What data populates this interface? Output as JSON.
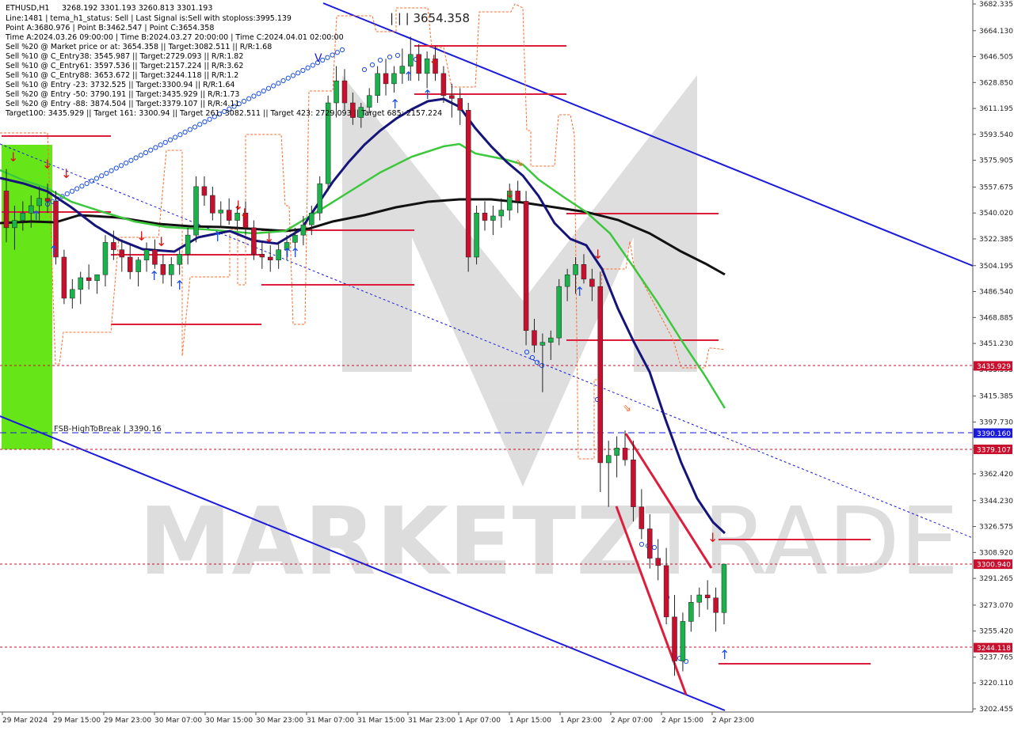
{
  "header": {
    "title": "ETHUSD,H1",
    "ohlc": "3268.192 3301.193 3260.813 3301.193",
    "line2": "Line:1481  |  tema_h1_status: Sell  |  Last Signal is:Sell with stoploss:3995.139",
    "line3": "Point A:3680.976  |  Point B:3462.547  |  Point C:3654.358",
    "line4": "Time A:2024.03.26 09:00:00  |  Time B:2024.03.27 20:00:00  |  Time C:2024.04.01 02:00:00",
    "line5": "Sell %20 @ Market price or at: 3654.358  ||  Target:3082.511  ||  R/R:1.68",
    "line6": "Sell %10 @ C_Entry38: 3545.987  ||  Target:2729.093  ||  R/R:1.82",
    "line7": "Sell %10 @ C_Entry61: 3597.536  ||  Target:2157.224  ||  R/R:3.62",
    "line8": "Sell %10 @ C_Entry88: 3653.672  ||  Target:3244.118  ||  R/R:1.2",
    "line9": "Sell %10 @ Entry -23: 3732.525  ||  Target:3300.94  ||  R/R:1.64",
    "line10": "Sell %20 @ Entry -50: 3790.191  ||  Target:3435.929  ||  R/R:1.73",
    "line11": "Sell %20 @ Entry -88: 3874.504  ||  Target:3379.107  ||  R/R:4.11",
    "line12": "Target100: 3435.929  ||  Target 161: 3300.94  ||  Target 261: 3082.511  ||  Target 423: 2729.093  ||  Target 685: 2157.224"
  },
  "annotations": {
    "point_c_label": "| | | 3654.358",
    "fsb_label": "FSB-HighToBreak  |  3390.16",
    "v_mark": "V"
  },
  "watermark": {
    "text_left": "MARKETZ",
    "text_right": "TRADE"
  },
  "colors": {
    "up_candle": "#19b24b",
    "down_candle": "#c8102e",
    "channel": "#1a1adb",
    "ma_dark_blue": "#14147a",
    "ma_green": "#3cc83c",
    "ma_black": "#111111",
    "level_red": "#dc1e3c",
    "envelope_orange": "#ff6a2a",
    "green_zone": "#66e619"
  },
  "chart_data": {
    "type": "candlestick",
    "symbol": "ETHUSD",
    "timeframe": "H1",
    "ylim": [
      3202.455,
      3682.335
    ],
    "y_ticks": [
      "3682.335",
      "3664.130",
      "3646.505",
      "3628.850",
      "3611.195",
      "3593.540",
      "3575.905",
      "3557.675",
      "3540.020",
      "3522.385",
      "3504.195",
      "3486.540",
      "3468.885",
      "3451.230",
      "3433.595",
      "3415.385",
      "3397.730",
      "3380.075",
      "3362.420",
      "3344.230",
      "3326.575",
      "3308.920",
      "3291.265",
      "3273.070",
      "3255.420",
      "3237.765",
      "3220.110",
      "3202.455"
    ],
    "x_ticks": [
      "29 Mar 2024",
      "29 Mar 15:00",
      "29 Mar 23:00",
      "30 Mar 07:00",
      "30 Mar 15:00",
      "30 Mar 23:00",
      "31 Mar 07:00",
      "31 Mar 15:00",
      "31 Mar 23:00",
      "1 Apr 07:00",
      "1 Apr 15:00",
      "1 Apr 23:00",
      "2 Apr 07:00",
      "2 Apr 15:00",
      "2 Apr 23:00"
    ],
    "price_badges": [
      {
        "label": "3435.929",
        "value": 3435.929,
        "color": "#c8102e"
      },
      {
        "label": "3390.160",
        "value": 3390.16,
        "color": "#1a1adb"
      },
      {
        "label": "3379.107",
        "value": 3379.107,
        "color": "#c8102e"
      },
      {
        "label": "3300.940",
        "value": 3300.94,
        "color": "#c8102e"
      },
      {
        "label": "3244.118",
        "value": 3244.118,
        "color": "#c8102e"
      }
    ],
    "candles": [
      [
        3555,
        3570,
        3520,
        3530
      ],
      [
        3530,
        3545,
        3515,
        3535
      ],
      [
        3535,
        3548,
        3528,
        3540
      ],
      [
        3540,
        3552,
        3530,
        3545
      ],
      [
        3545,
        3558,
        3535,
        3550
      ],
      [
        3550,
        3560,
        3540,
        3548
      ],
      [
        3548,
        3555,
        3505,
        3510
      ],
      [
        3510,
        3515,
        3478,
        3482
      ],
      [
        3482,
        3495,
        3475,
        3488
      ],
      [
        3488,
        3500,
        3478,
        3496
      ],
      [
        3496,
        3505,
        3488,
        3494
      ],
      [
        3494,
        3498,
        3485,
        3498
      ],
      [
        3498,
        3525,
        3490,
        3520
      ],
      [
        3520,
        3528,
        3508,
        3515
      ],
      [
        3515,
        3522,
        3500,
        3510
      ],
      [
        3510,
        3518,
        3495,
        3500
      ],
      [
        3500,
        3510,
        3490,
        3508
      ],
      [
        3508,
        3520,
        3500,
        3515
      ],
      [
        3515,
        3522,
        3502,
        3505
      ],
      [
        3505,
        3512,
        3492,
        3498
      ],
      [
        3498,
        3510,
        3490,
        3505
      ],
      [
        3505,
        3515,
        3498,
        3512
      ],
      [
        3512,
        3530,
        3505,
        3525
      ],
      [
        3525,
        3565,
        3520,
        3558
      ],
      [
        3558,
        3565,
        3545,
        3552
      ],
      [
        3552,
        3558,
        3535,
        3540
      ],
      [
        3540,
        3548,
        3530,
        3542
      ],
      [
        3542,
        3550,
        3532,
        3535
      ],
      [
        3535,
        3545,
        3528,
        3540
      ],
      [
        3540,
        3548,
        3525,
        3530
      ],
      [
        3530,
        3535,
        3508,
        3512
      ],
      [
        3512,
        3520,
        3502,
        3510
      ],
      [
        3510,
        3518,
        3500,
        3508
      ],
      [
        3508,
        3520,
        3502,
        3515
      ],
      [
        3515,
        3525,
        3508,
        3520
      ],
      [
        3520,
        3530,
        3515,
        3525
      ],
      [
        3525,
        3538,
        3518,
        3532
      ],
      [
        3532,
        3545,
        3525,
        3540
      ],
      [
        3540,
        3565,
        3535,
        3560
      ],
      [
        3560,
        3620,
        3555,
        3615
      ],
      [
        3615,
        3640,
        3605,
        3630
      ],
      [
        3630,
        3638,
        3610,
        3615
      ],
      [
        3615,
        3622,
        3600,
        3605
      ],
      [
        3605,
        3615,
        3598,
        3612
      ],
      [
        3612,
        3625,
        3608,
        3620
      ],
      [
        3620,
        3640,
        3615,
        3635
      ],
      [
        3635,
        3645,
        3620,
        3628
      ],
      [
        3628,
        3640,
        3622,
        3635
      ],
      [
        3635,
        3652,
        3628,
        3640
      ],
      [
        3640,
        3660,
        3630,
        3648
      ],
      [
        3648,
        3655,
        3630,
        3635
      ],
      [
        3635,
        3650,
        3625,
        3645
      ],
      [
        3645,
        3654,
        3630,
        3635
      ],
      [
        3635,
        3640,
        3615,
        3620
      ],
      [
        3620,
        3628,
        3605,
        3618
      ],
      [
        3618,
        3625,
        3600,
        3610
      ],
      [
        3610,
        3615,
        3500,
        3510
      ],
      [
        3510,
        3545,
        3505,
        3540
      ],
      [
        3540,
        3548,
        3528,
        3535
      ],
      [
        3535,
        3545,
        3525,
        3538
      ],
      [
        3538,
        3550,
        3530,
        3542
      ],
      [
        3542,
        3560,
        3535,
        3555
      ],
      [
        3555,
        3562,
        3540,
        3548
      ],
      [
        3548,
        3555,
        3450,
        3460
      ],
      [
        3460,
        3468,
        3445,
        3450
      ],
      [
        3450,
        3458,
        3418,
        3452
      ],
      [
        3452,
        3460,
        3440,
        3455
      ],
      [
        3455,
        3495,
        3450,
        3490
      ],
      [
        3490,
        3502,
        3480,
        3498
      ],
      [
        3498,
        3510,
        3485,
        3505
      ],
      [
        3505,
        3512,
        3492,
        3495
      ],
      [
        3495,
        3502,
        3480,
        3490
      ],
      [
        3490,
        3500,
        3350,
        3370
      ],
      [
        3370,
        3385,
        3340,
        3375
      ],
      [
        3375,
        3388,
        3360,
        3380
      ],
      [
        3380,
        3392,
        3368,
        3372
      ],
      [
        3372,
        3385,
        3330,
        3340
      ],
      [
        3340,
        3352,
        3318,
        3325
      ],
      [
        3325,
        3335,
        3298,
        3305
      ],
      [
        3305,
        3318,
        3290,
        3300
      ],
      [
        3300,
        3312,
        3260,
        3265
      ],
      [
        3265,
        3280,
        3225,
        3235
      ],
      [
        3235,
        3268,
        3228,
        3262
      ],
      [
        3262,
        3280,
        3255,
        3275
      ],
      [
        3275,
        3285,
        3265,
        3280
      ],
      [
        3280,
        3290,
        3270,
        3278
      ],
      [
        3278,
        3285,
        3255,
        3268
      ],
      [
        3268,
        3301,
        3260,
        3301
      ]
    ]
  }
}
